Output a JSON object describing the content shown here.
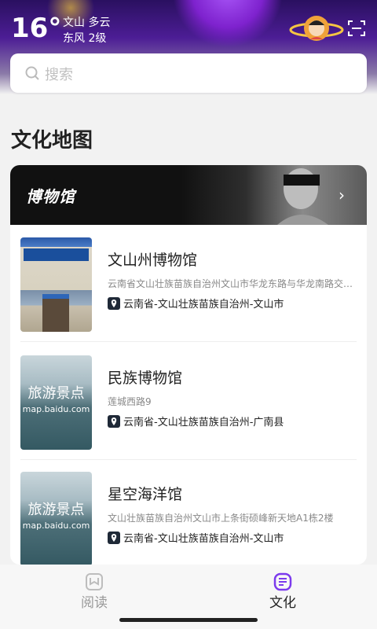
{
  "status": {
    "temperature": "16°",
    "location_weather": "文山 多云",
    "wind": "东风 2级"
  },
  "search": {
    "placeholder": "搜索"
  },
  "section": {
    "title": "文化地图"
  },
  "banner": {
    "title": "博物馆",
    "chevron": "›"
  },
  "items": [
    {
      "name": "文山州博物馆",
      "address": "云南省文山壮族苗族自治州文山市华龙东路与华龙南路交叉口",
      "region": "云南省-文山壮族苗族自治州-文山市"
    },
    {
      "name": "民族博物馆",
      "address": "莲城西路9",
      "region": "云南省-文山壮族苗族自治州-广南县",
      "thumb_text_1": "旅游景点",
      "thumb_text_2": "map.baidu.com"
    },
    {
      "name": "星空海洋馆",
      "address": "文山壮族苗族自治州文山市上条街硕峰新天地A1栋2楼",
      "region": "云南省-文山壮族苗族自治州-文山市",
      "thumb_text_1": "旅游景点",
      "thumb_text_2": "map.baidu.com"
    }
  ],
  "tabs": [
    {
      "label": "阅读",
      "icon": "book-icon",
      "active": false,
      "color": "#999999"
    },
    {
      "label": "文化",
      "icon": "culture-icon",
      "active": true,
      "color": "#222222"
    }
  ],
  "colors": {
    "accent": "#7c3aed",
    "hero": "#4c1d95"
  }
}
